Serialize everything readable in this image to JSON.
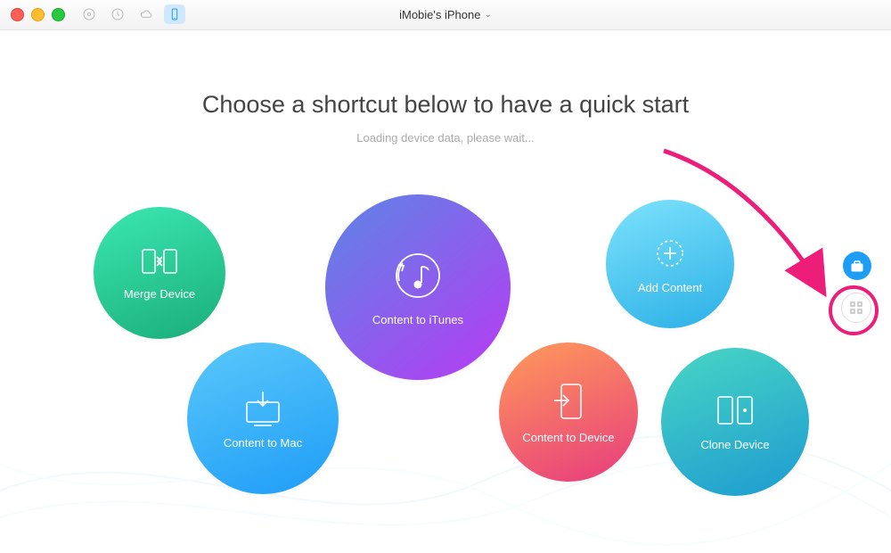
{
  "titlebar": {
    "device_name": "iMobie's iPhone"
  },
  "heading": "Choose a shortcut below to have a quick start",
  "subheading": "Loading device data, please wait...",
  "bubbles": {
    "merge": "Merge Device",
    "mac": "Content to Mac",
    "itunes": "Content to iTunes",
    "device": "Content to Device",
    "add": "Add Content",
    "clone": "Clone Device"
  }
}
